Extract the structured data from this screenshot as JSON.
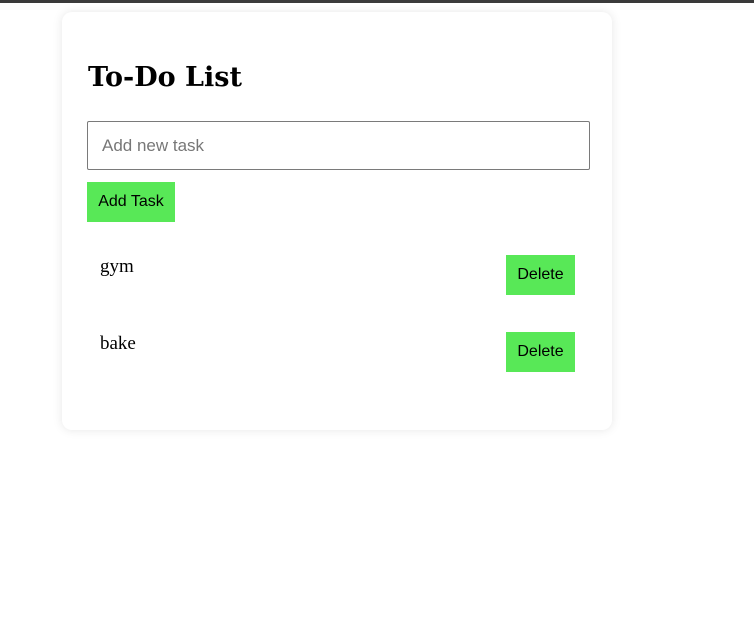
{
  "app": {
    "title": "To-Do List"
  },
  "input": {
    "value": "",
    "placeholder": "Add new task"
  },
  "actions": {
    "add_label": "Add Task"
  },
  "tasks": [
    {
      "text": "gym",
      "delete_label": "Delete"
    },
    {
      "text": "bake",
      "delete_label": "Delete"
    }
  ],
  "colors": {
    "button_bg": "#58e857",
    "card_bg": "#ffffff",
    "top_bar": "#3a3a3a"
  }
}
